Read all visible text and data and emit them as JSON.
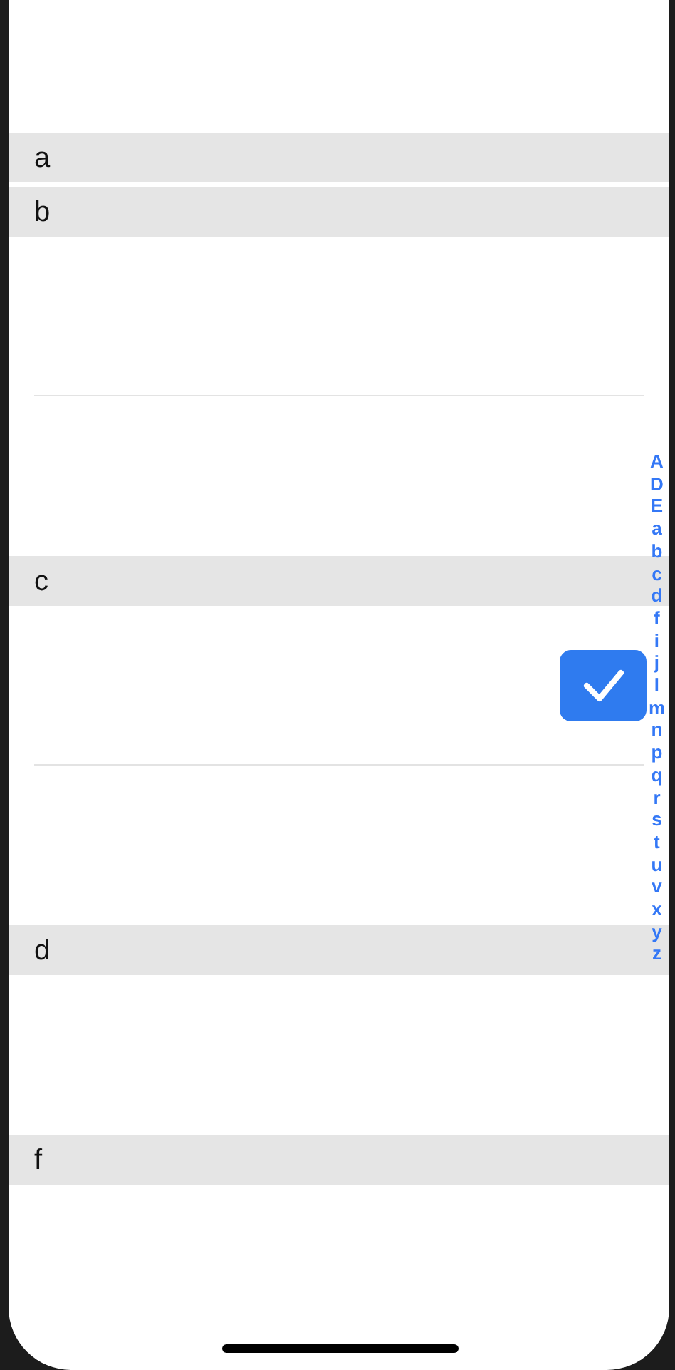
{
  "sections": [
    {
      "header": "a"
    },
    {
      "header": "b",
      "rows": [
        {
          "kind": "blank"
        },
        {
          "kind": "blank"
        }
      ]
    },
    {
      "header": "c",
      "rows": [
        {
          "kind": "checkbox",
          "checked": true
        },
        {
          "kind": "blank"
        }
      ]
    },
    {
      "header": "d",
      "rows": [
        {
          "kind": "blank"
        }
      ]
    },
    {
      "header": "f"
    }
  ],
  "index": [
    "A",
    "D",
    "E",
    "a",
    "b",
    "c",
    "d",
    "f",
    "i",
    "j",
    "l",
    "m",
    "n",
    "p",
    "q",
    "r",
    "s",
    "t",
    "u",
    "v",
    "x",
    "y",
    "z"
  ]
}
